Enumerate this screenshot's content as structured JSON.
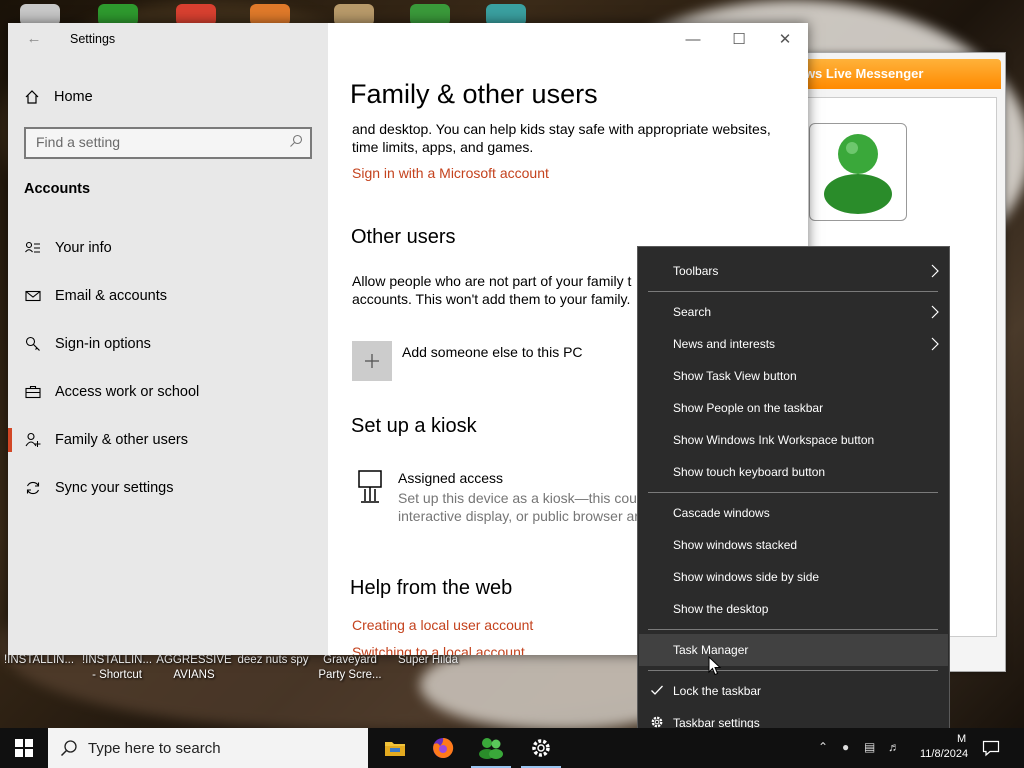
{
  "settings": {
    "window_title": "Settings",
    "nav": {
      "home": "Home",
      "search_placeholder": "Find a setting",
      "section": "Accounts",
      "items": [
        {
          "label": "Your info",
          "icon": "your-info-icon"
        },
        {
          "label": "Email & accounts",
          "icon": "email-icon"
        },
        {
          "label": "Sign-in options",
          "icon": "key-icon"
        },
        {
          "label": "Access work or school",
          "icon": "briefcase-icon"
        },
        {
          "label": "Family & other users",
          "icon": "family-icon",
          "active": true
        },
        {
          "label": "Sync your settings",
          "icon": "sync-icon"
        }
      ]
    },
    "main": {
      "title": "Family & other users",
      "intro_line1": "and desktop. You can help kids stay safe with appropriate websites,",
      "intro_line2": "time limits, apps, and games.",
      "signin_link": "Sign in with a Microsoft account",
      "other_users_heading": "Other users",
      "other_users_line1": "Allow people who are not part of your family t",
      "other_users_line2": "accounts. This won't add them to your family.",
      "add_someone": "Add someone else to this PC",
      "kiosk_heading": "Set up a kiosk",
      "assigned_access_title": "Assigned access",
      "assigned_access_line1": "Set up this device as a kiosk—this coul",
      "assigned_access_line2": "interactive display, or public browser ar",
      "help_heading": "Help from the web",
      "help_link1": "Creating a local user account",
      "help_link2": "Switching to a local account"
    }
  },
  "messenger": {
    "title": "ows Live Messenger"
  },
  "context_menu": {
    "items": [
      {
        "label": "Toolbars",
        "submenu": true
      },
      {
        "label": "Search",
        "submenu": true
      },
      {
        "label": "News and interests",
        "submenu": true
      },
      {
        "label": "Show Task View button"
      },
      {
        "label": "Show People on the taskbar"
      },
      {
        "label": "Show Windows Ink Workspace button"
      },
      {
        "label": "Show touch keyboard button"
      },
      {
        "label": "Cascade windows"
      },
      {
        "label": "Show windows stacked"
      },
      {
        "label": "Show windows side by side"
      },
      {
        "label": "Show the desktop"
      },
      {
        "label": "Task Manager",
        "hover": true
      },
      {
        "label": "Lock the taskbar",
        "checked": true
      },
      {
        "label": "Taskbar settings",
        "icon": "gear-icon"
      }
    ]
  },
  "desktop_icons": [
    {
      "label_line1": "!INSTALLIN...",
      "label_line2": ""
    },
    {
      "label_line1": "!INSTALLIN...",
      "label_line2": "- Shortcut"
    },
    {
      "label_line1": "AGGRESSIVE",
      "label_line2": "AVIANS"
    },
    {
      "label_line1": "deez nuts spy",
      "label_line2": ""
    },
    {
      "label_line1": "Graveyard",
      "label_line2": "Party Scre..."
    },
    {
      "label_line1": "Super Hilda",
      "label_line2": ""
    }
  ],
  "taskbar": {
    "search_placeholder": "Type here to search",
    "apps": [
      "file-explorer-icon",
      "firefox-icon",
      "messenger-icon",
      "settings-gear-icon"
    ],
    "clock_time": "M",
    "clock_date": "11/8/2024"
  },
  "colors": {
    "accent": "#c4421d",
    "menu_bg": "#2b2b2b",
    "taskbar_bg": "#101010",
    "sidebar_bg": "#e8e8e8"
  }
}
